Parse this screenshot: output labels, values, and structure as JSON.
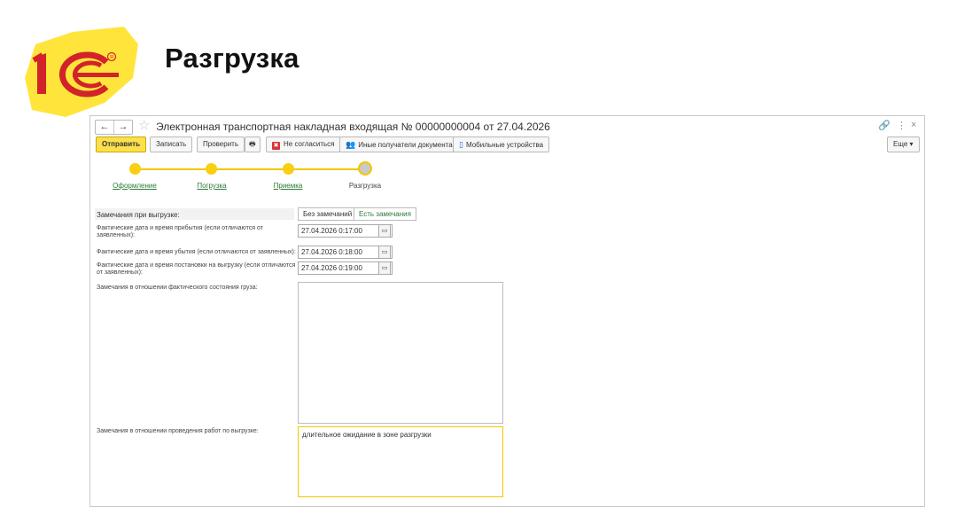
{
  "slide": {
    "title": "Разгрузка"
  },
  "window": {
    "document_title": "Электронная транспортная накладная входящая № 00000000004 от 27.04.2026",
    "nav": {
      "back": "←",
      "forward": "→"
    },
    "controls": {
      "link": "🔗",
      "more": "⋮",
      "close": "×"
    }
  },
  "toolbar": {
    "send": "Отправить",
    "save": "Записать",
    "check": "Проверить",
    "print": "🖶",
    "disagree": "Не согласиться",
    "other_recipients": "Иные получатели документа",
    "mobile_devices": "Мобильные устройства",
    "more": "Еще ▾"
  },
  "steps": [
    {
      "label": "Оформление",
      "state": "done"
    },
    {
      "label": "Погрузка",
      "state": "done"
    },
    {
      "label": "Приемка",
      "state": "done"
    },
    {
      "label": "Разгрузка",
      "state": "current"
    }
  ],
  "form": {
    "remarks_label": "Замечания при выгрузке:",
    "remarks_options": [
      "Без замечаний",
      "Есть замечания"
    ],
    "arrival_label": "Фактические дата и время прибытия (если отличаются от заявленных):",
    "arrival_value": "27.04.2026  0:17:00",
    "departure_label": "Фактические дата и время убытия (если отличаются от заявленных):",
    "departure_value": "27.04.2026  0:18:00",
    "placement_label": "Фактические дата и время постановки на выгрузку (если отличаются от заявленных):",
    "placement_value": "27.04.2026  0:19:00",
    "cargo_remarks_label": "Замечания в отношении фактического состояния груза:",
    "cargo_remarks_value": "",
    "works_remarks_label": "Замечания в отношении проведения работ по выгрузке:",
    "works_remarks_value": "длительное ожидание в зоне разгрузки"
  },
  "colors": {
    "accent": "#f2c700",
    "link": "#2c7a3a",
    "logo_red": "#d2232a",
    "logo_yellow": "#ffe53b"
  }
}
